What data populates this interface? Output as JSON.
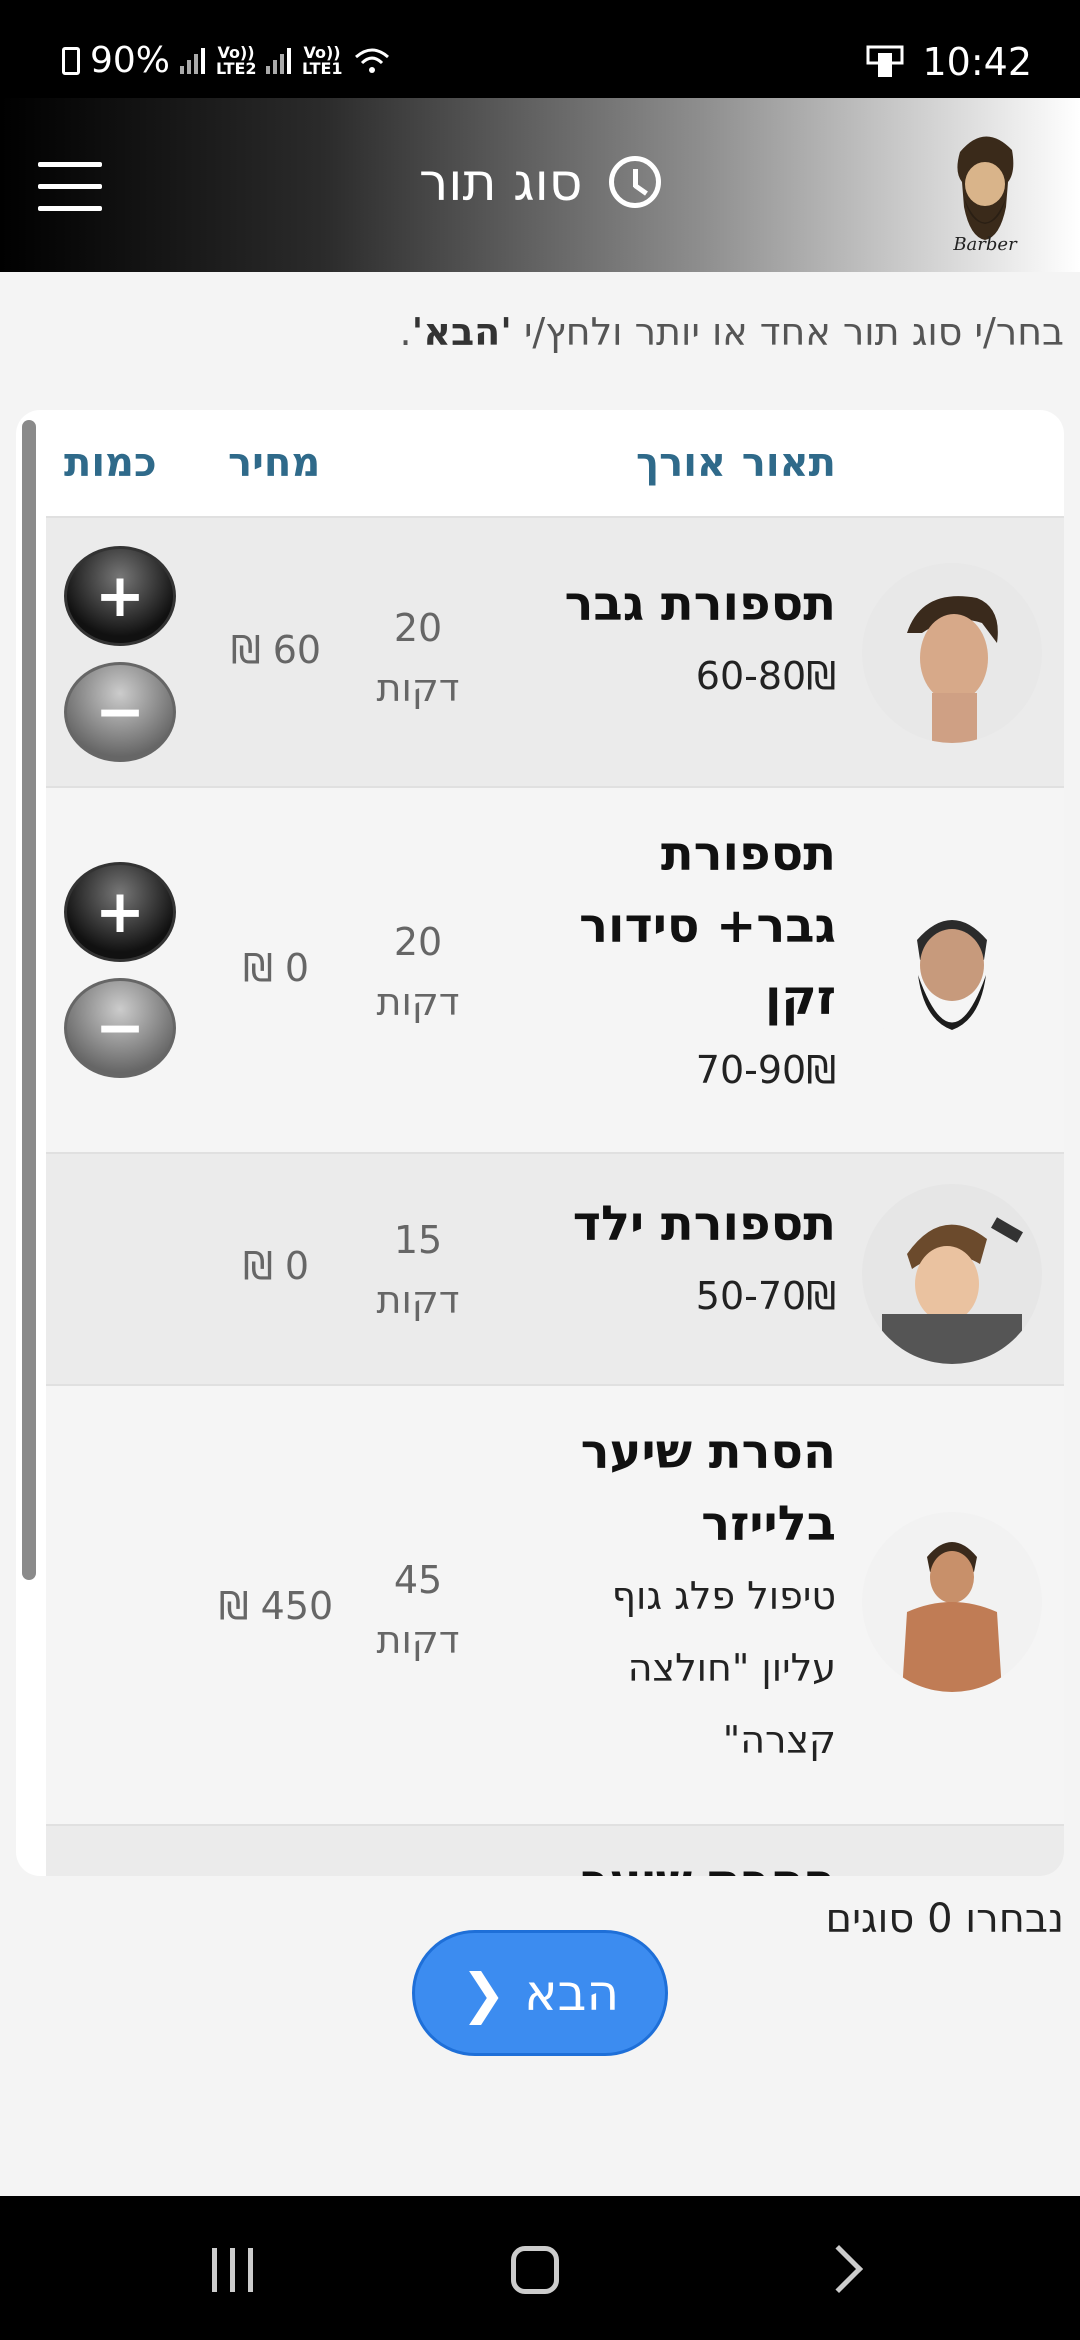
{
  "status": {
    "battery": "90%",
    "sim1": "Vo)) LTE2",
    "sim2": "Vo)) LTE1",
    "time": "10:42"
  },
  "header": {
    "title": "סוג תור",
    "menu_icon": "hamburger-icon",
    "clock_icon": "clock-icon",
    "logo_text": "Barber"
  },
  "instruction": {
    "text": "בחר/י סוג תור אחד או יותר ולחץ/י ",
    "emph": "'הבא'",
    "end": "."
  },
  "table": {
    "columns": {
      "desc": "תאור",
      "length": "אורך",
      "price": "מחיר",
      "qty": "כמות"
    },
    "rows": [
      {
        "name": "תספורת גבר",
        "sub": "60-80₪",
        "length_num": "20",
        "length_unit": "דקות",
        "price": "₪ 60",
        "plus": "+",
        "minus": "−"
      },
      {
        "name": "תספורת גבר+ סידור זקן",
        "sub": "70-90₪",
        "length_num": "20",
        "length_unit": "דקות",
        "price": "₪ 0",
        "plus": "+",
        "minus": "−"
      },
      {
        "name": "תספורת ילד",
        "sub": "50-70₪",
        "length_num": "15",
        "length_unit": "דקות",
        "price": "₪ 0"
      },
      {
        "name": "הסרת שיער בלייזר",
        "sub": "טיפול פלג גוף עליון \"חולצה קצרה\"",
        "length_num": "45",
        "length_unit": "דקות",
        "price": "₪ 450"
      },
      {
        "name": "הסרת שיער"
      }
    ]
  },
  "footer": {
    "selected": "נבחרו 0 סוגים",
    "next_label": "הבא"
  }
}
